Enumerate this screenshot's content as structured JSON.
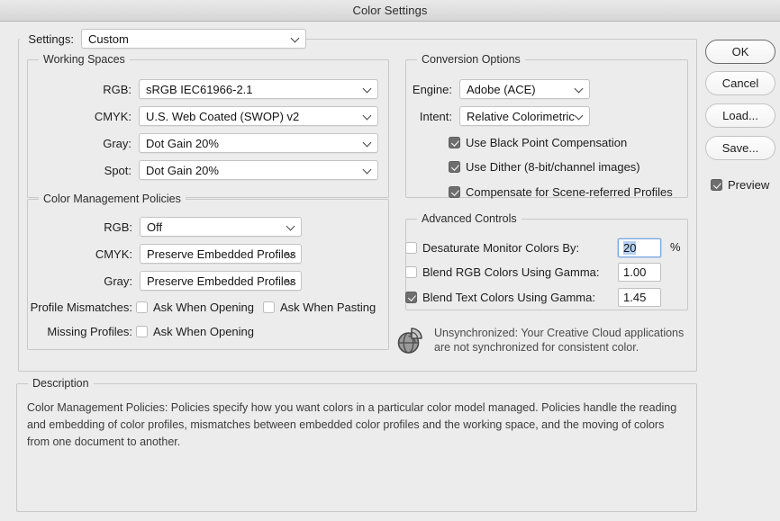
{
  "window": {
    "title": "Color Settings"
  },
  "settings_row": {
    "label": "Settings:",
    "value": "Custom",
    "chevron": "chevron-down-icon"
  },
  "working_spaces": {
    "legend": "Working Spaces",
    "rows": [
      {
        "label": "RGB:",
        "value": "sRGB IEC61966-2.1"
      },
      {
        "label": "CMYK:",
        "value": "U.S. Web Coated (SWOP) v2"
      },
      {
        "label": "Gray:",
        "value": "Dot Gain 20%"
      },
      {
        "label": "Spot:",
        "value": "Dot Gain 20%"
      }
    ]
  },
  "color_management_policies": {
    "legend": "Color Management Policies",
    "rows": [
      {
        "label": "RGB:",
        "value": "Off"
      },
      {
        "label": "CMYK:",
        "value": "Preserve Embedded Profiles"
      },
      {
        "label": "Gray:",
        "value": "Preserve Embedded Profiles"
      }
    ],
    "profile_mismatches": {
      "label": "Profile Mismatches:",
      "ask_when_opening": {
        "label": "Ask When Opening",
        "checked": false
      },
      "ask_when_pasting": {
        "label": "Ask When Pasting",
        "checked": false
      }
    },
    "missing_profiles": {
      "label": "Missing Profiles:",
      "ask_when_opening": {
        "label": "Ask When Opening",
        "checked": false
      }
    }
  },
  "conversion_options": {
    "legend": "Conversion Options",
    "rows": [
      {
        "label": "Engine:",
        "value": "Adobe (ACE)"
      },
      {
        "label": "Intent:",
        "value": "Relative Colorimetric"
      }
    ],
    "checks": [
      {
        "label": "Use Black Point Compensation",
        "checked": true
      },
      {
        "label": "Use Dither (8-bit/channel images)",
        "checked": true
      },
      {
        "label": "Compensate for Scene-referred Profiles",
        "checked": true
      }
    ]
  },
  "advanced_controls": {
    "legend": "Advanced Controls",
    "rows": [
      {
        "label": "Desaturate Monitor Colors By:",
        "checked": false,
        "value": "20",
        "suffix": "%",
        "focused": true,
        "selected": true
      },
      {
        "label": "Blend RGB Colors Using Gamma:",
        "checked": false,
        "value": "1.00",
        "suffix": "",
        "focused": false,
        "selected": false
      },
      {
        "label": "Blend Text Colors Using Gamma:",
        "checked": true,
        "value": "1.45",
        "suffix": "",
        "focused": false,
        "selected": false
      }
    ]
  },
  "sync_notice": {
    "icon": "globe-sync-icon",
    "text": "Unsynchronized: Your Creative Cloud applications are not synchronized for consistent color."
  },
  "description": {
    "legend": "Description",
    "text": "Color Management Policies:  Policies specify how you want colors in a particular color model managed.  Policies handle the reading and embedding of color profiles, mismatches between embedded color profiles and the working space, and the moving of colors from one document to another."
  },
  "buttons": {
    "ok": "OK",
    "cancel": "Cancel",
    "load": "Load...",
    "save": "Save..."
  },
  "preview": {
    "label": "Preview",
    "checked": true
  },
  "colors": {
    "window_bg": "#ececec",
    "field_bg": "#ffffff",
    "group_border": "#c8c8c8",
    "accent_selection": "#b4d0f0",
    "focus_border": "#7aa7e0",
    "checkbox_on": "#6e6e6e"
  }
}
